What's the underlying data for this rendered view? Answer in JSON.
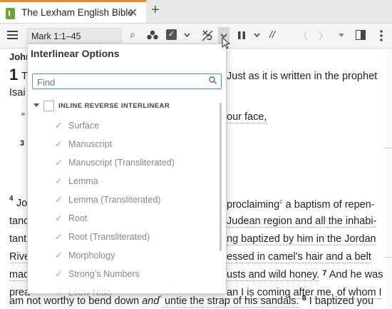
{
  "tab": {
    "title": "The Lexham English Bible",
    "close": "✕",
    "new": "+"
  },
  "toolbar": {
    "reference": "Mark 1:1–45",
    "search": "⌕",
    "nodes": "⋯",
    "separator": "//",
    "prev": "〈",
    "next": "〉"
  },
  "document": {
    "heading": "John",
    "verse1_num": "1",
    "verse1_start": "T",
    "verse1_end": "Just as it is written in the prophet",
    "isaiah": "Isai",
    "quote_open": "“",
    "your_face": "our face,",
    "verse3": "3",
    "verse4_num": "4",
    "line4a_start": "Jo",
    "line4a_end": "proclaiming",
    "line4a_note": "c",
    "line4a_rest": " a baptism of repen-",
    "line4b_start": "tanc",
    "line4b_end": "Judean region and all the inhabi-",
    "line4c_start": "tant",
    "line4c_end": "ng baptized by him in the Jordan",
    "line4d_start": "Rive",
    "line4d_end": "essed in camel’s hair and a belt",
    "line4e_start": "mad",
    "line4e_end": "usts and wild honey.",
    "verse7_num": "7",
    "line4e_rest": " And he was",
    "line4f_start": "prea",
    "line4f_end": "an I is coming after me, of whom I",
    "line4g": "am  not worthy to bend down ",
    "and_word": "and",
    "star": "*",
    "line4g_rest": " untie the strap of his sandals.",
    "verse8_num": "8",
    "line4g_tail": " I baptized you"
  },
  "popup": {
    "title": "Interlinear Options",
    "find_placeholder": "Find",
    "group_label": "INLINE REVERSE INTERLINEAR",
    "items": [
      "Surface",
      "Manuscript",
      "Manuscript (Transliterated)",
      "Lemma",
      "Lemma (Transliterated)",
      "Root",
      "Root (Transliterated)",
      "Morphology",
      "Strong’s Numbers",
      "Louw-Nida"
    ]
  }
}
